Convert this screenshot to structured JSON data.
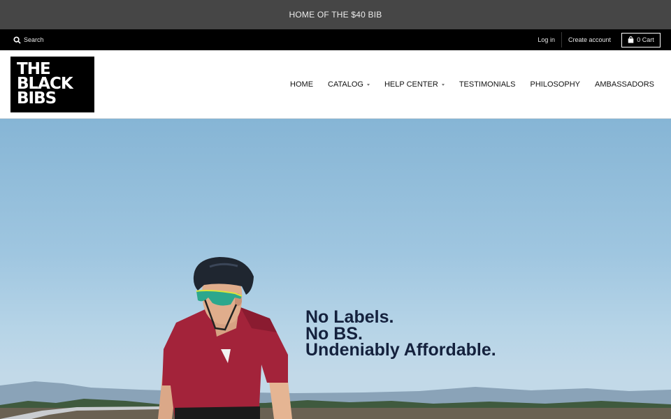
{
  "announcement": {
    "text": "HOME OF THE $40 BIB"
  },
  "utility": {
    "search_label": "Search",
    "login_label": "Log in",
    "create_account_label": "Create account",
    "cart_label": "0 Cart",
    "search_icon": "search-icon",
    "cart_icon": "shopping-bag-icon"
  },
  "logo": {
    "lines": [
      "THE",
      "BLACK",
      "BIBS"
    ]
  },
  "nav": {
    "items": [
      {
        "label": "HOME"
      },
      {
        "label": "CATALOG"
      },
      {
        "label": "HELP CENTER"
      },
      {
        "label": "TESTIMONIALS"
      },
      {
        "label": "PHILOSOPHY"
      },
      {
        "label": "AMBASSADORS"
      }
    ]
  },
  "hero": {
    "lines": [
      "No Labels.",
      "No BS.",
      "Undeniably Affordable."
    ]
  },
  "colors": {
    "announcement_bg": "#464646",
    "utility_bg": "#000000",
    "header_bg": "#ffffff",
    "headline": "#14213d",
    "jersey": "#a3233a"
  }
}
